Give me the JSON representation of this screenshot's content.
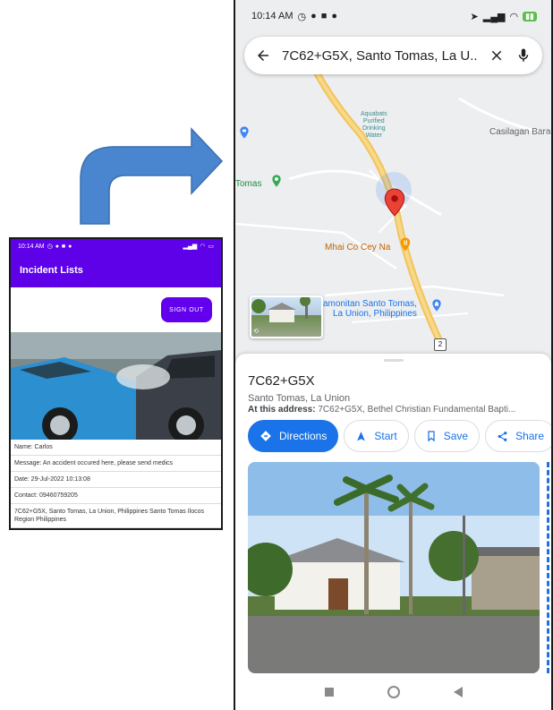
{
  "left_app": {
    "status_time": "10:14 AM",
    "toolbar_title": "Incident Lists",
    "signout_label": "SIGN OUT",
    "details": {
      "name": "Name: Carlos",
      "message": "Message: An accident occured here, please send medics",
      "date": "Date: 29-Jul-2022 10:13:08",
      "contact": "Contact: 09460759205",
      "location": "7C62+G5X, Santo Tomas, La Union, Philippines Santo Tomas Ilocos Region Philippines"
    },
    "accent_color": "#6200ee"
  },
  "right_app": {
    "status_time": "10:14 AM",
    "search_query": "7C62+G5X, Santo Tomas, La U...",
    "map_labels": {
      "aquabats": "Aquabats\nPurified\nDrinking\nWater",
      "casilagan": "Casilagan Bara",
      "tomas": "Tomas",
      "mhai": "Mhai Co Cey Na",
      "amonitan": "amonitan Santo Tomas,\nLa Union, Philippines",
      "road_shield": "2"
    },
    "place": {
      "title": "7C62+G5X",
      "subtitle": "Santo Tomas, La Union",
      "address_label": "At this address:",
      "address_value": "7C62+G5X, Bethel Christian Fundamental Bapti..."
    },
    "actions": {
      "directions": "Directions",
      "start": "Start",
      "save": "Save",
      "share": "Share"
    },
    "icons": [
      "back-arrow-icon",
      "close-icon",
      "microphone-icon",
      "directions-icon",
      "navigation-icon",
      "bookmark-icon",
      "share-icon",
      "map-pin-icon",
      "shopping-icon",
      "restaurant-icon"
    ],
    "accent_color": "#1a73e8"
  }
}
